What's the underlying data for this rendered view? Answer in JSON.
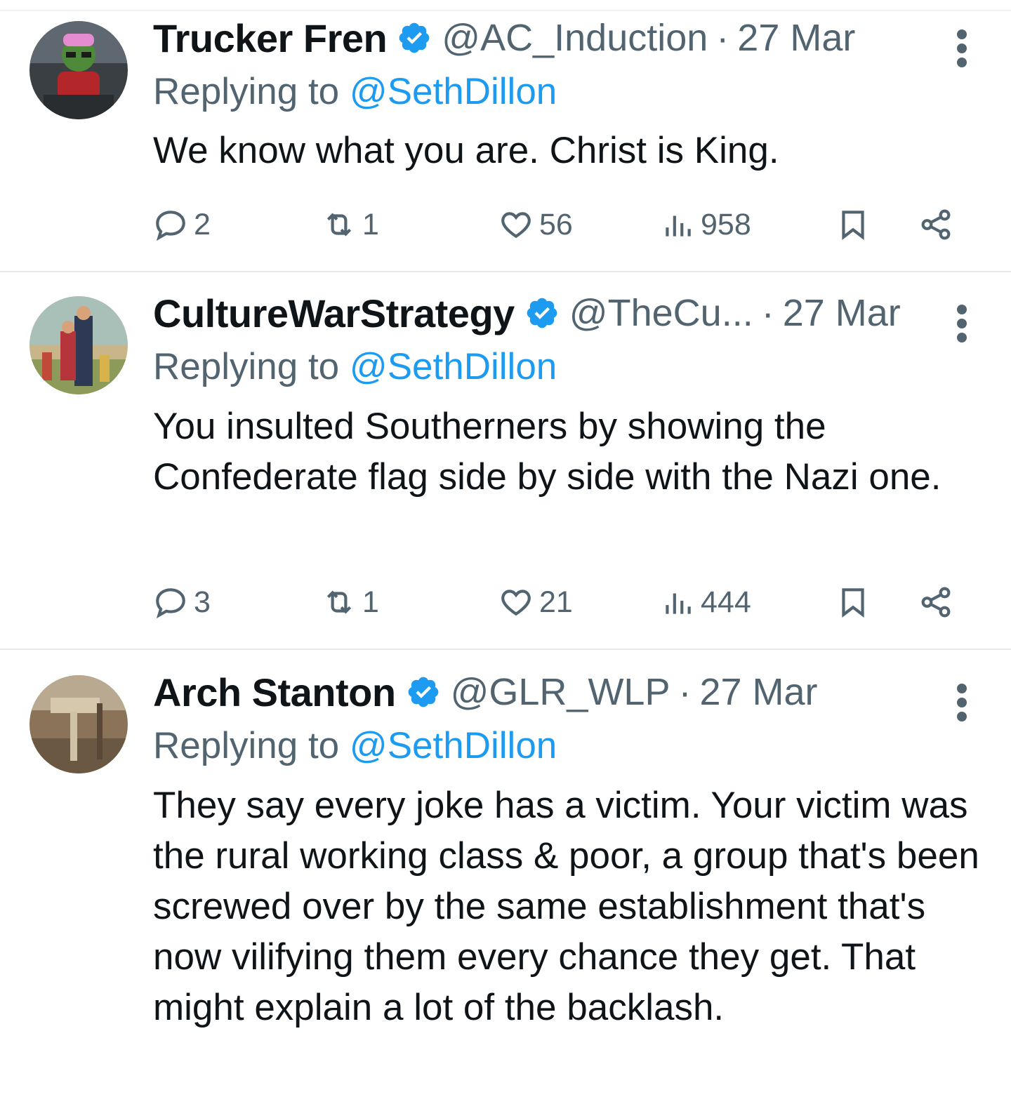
{
  "tweets": [
    {
      "name": "Trucker Fren",
      "handle": "@AC_Induction",
      "separator": "·",
      "date": "27 Mar",
      "replying_prefix": "Replying to ",
      "replying_to": "@SethDillon",
      "text": "We know what you are. Christ is King.",
      "replies": "2",
      "retweets": "1",
      "likes": "56",
      "views": "958"
    },
    {
      "name": "CultureWarStrategy",
      "handle": "@TheCu...",
      "separator": "·",
      "date": "27 Mar",
      "replying_prefix": "Replying to ",
      "replying_to": "@SethDillon",
      "text": "You insulted Southerners by showing the Confederate flag side by side with the Nazi one.",
      "replies": "3",
      "retweets": "1",
      "likes": "21",
      "views": "444"
    },
    {
      "name": "Arch Stanton",
      "handle": "@GLR_WLP",
      "separator": "·",
      "date": "27 Mar",
      "replying_prefix": "Replying to ",
      "replying_to": "@SethDillon",
      "text": "They say every joke has a victim. Your victim was the rural working class & poor, a group that's been screwed over by the same establishment that's now vilifying them every chance they get. That might explain a lot of the backlash."
    }
  ],
  "colors": {
    "verified": "#1d9bf0",
    "link": "#1d9bf0",
    "secondary_text": "#536471"
  },
  "icons": [
    "verified-badge-icon",
    "more-options-icon",
    "reply-icon",
    "retweet-icon",
    "like-icon",
    "views-icon",
    "bookmark-icon",
    "share-icon"
  ]
}
